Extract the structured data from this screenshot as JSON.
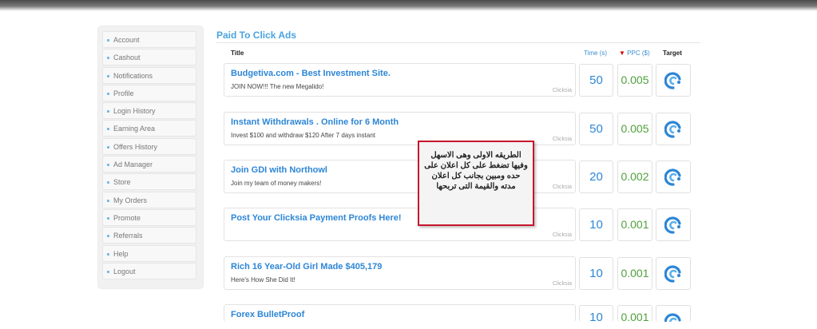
{
  "sidebar": {
    "items": [
      {
        "label": "Account"
      },
      {
        "label": "Cashout"
      },
      {
        "label": "Notifications"
      },
      {
        "label": "Profile"
      },
      {
        "label": "Login History"
      },
      {
        "label": "Earning Area"
      },
      {
        "label": "Offers History"
      },
      {
        "label": "Ad Manager"
      },
      {
        "label": "Store"
      },
      {
        "label": "My Orders"
      },
      {
        "label": "Promote"
      },
      {
        "label": "Referrals"
      },
      {
        "label": "Help"
      },
      {
        "label": "Logout"
      }
    ]
  },
  "main": {
    "heading": "Paid To Click Ads",
    "columns": {
      "title": "Title",
      "time": "Time (s)",
      "ppc": "PPC ($)",
      "target": "Target"
    },
    "ads": [
      {
        "title": "Budgetiva.com - Best Investment Site.",
        "desc": "JOIN NOW!!! The new Megalido!",
        "source": "Clicksia",
        "time": "50",
        "ppc": "0.005"
      },
      {
        "title": "Instant Withdrawals . Online for 6 Month",
        "desc": "Invest $100 and withdraw $120 After 7 days instant",
        "source": "Clicksia",
        "time": "50",
        "ppc": "0.005"
      },
      {
        "title": "Join GDI with Northowl",
        "desc": "Join my team of money makers!",
        "source": "Clicksia",
        "time": "20",
        "ppc": "0.002"
      },
      {
        "title": "Post Your Clicksia Payment Proofs Here!",
        "desc": "",
        "source": "Clicksia",
        "time": "10",
        "ppc": "0.001"
      },
      {
        "title": "Rich 16 Year-Old Girl Made $405,179",
        "desc": "Here's How She Did It!",
        "source": "Clicksia",
        "time": "10",
        "ppc": "0.001"
      },
      {
        "title": "Forex BulletProof",
        "desc": "",
        "source": "",
        "time": "10",
        "ppc": "0.001"
      }
    ]
  },
  "annotation": {
    "text": "الطريقه الاولى وهى الاسهل وفيها تضغط على كل اعلان على حده ومبين بجانب كل اعلان مدته والقيمة التى تربحها",
    "border_color": "#c9162a"
  },
  "colors": {
    "accent": "#4aa3df",
    "link": "#2d86d6",
    "ppc": "#4ea13a",
    "sort_arrow": "#dd0000"
  },
  "icons": {
    "sidebar_bullet": "bullet-icon",
    "target": "target-spiral-icon",
    "sort": "sort-down-arrow-icon"
  }
}
